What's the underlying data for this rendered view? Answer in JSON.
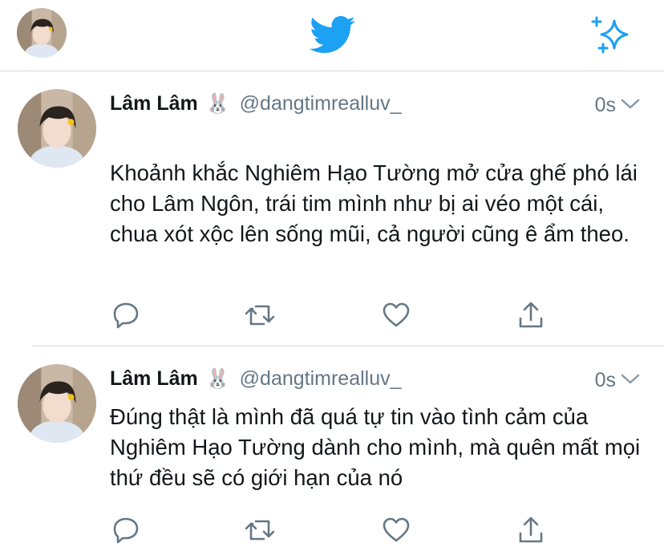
{
  "app": {
    "logo_icon": "twitter-bird-icon",
    "compose_icon": "sparkle-icon",
    "brand_color": "#1da1f2"
  },
  "tweets": [
    {
      "name": "Lâm Lâm",
      "emoji": "🐰",
      "handle": "@dangtimrealluv_",
      "time": "0s",
      "text": "Khoảnh khắc Nghiêm Hạo Tường mở cửa ghế phó lái cho Lâm Ngôn, trái tim mình như bị ai véo một cái, chua xót xộc lên sống mũi, cả người cũng ê ẩm theo."
    },
    {
      "name": "Lâm Lâm",
      "emoji": "🐰",
      "handle": "@dangtimrealluv_",
      "time": "0s",
      "text": "Đúng thật là mình đã quá tự tin vào tình cảm của Nghiêm Hạo Tường dành cho mình, mà quên mất mọi thứ đều sẽ có giới hạn của nó"
    }
  ]
}
